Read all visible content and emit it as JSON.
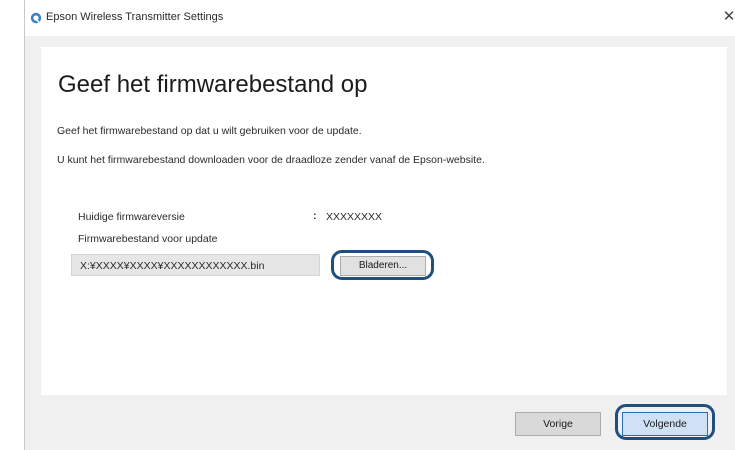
{
  "window": {
    "title": "Epson Wireless Transmitter Settings",
    "close_symbol": "✕",
    "icon": "epson-settings-icon"
  },
  "page": {
    "heading": "Geef het firmwarebestand op",
    "description_1": "Geef het firmwarebestand op dat u wilt gebruiken voor de update.",
    "description_2": "U kunt het firmwarebestand downloaden voor de draadloze zender vanaf de Epson-website."
  },
  "firmware": {
    "current_version_label": "Huidige firmwareversie",
    "separator": ":",
    "current_version_value": "XXXXXXXX",
    "file_label": "Firmwarebestand voor update",
    "file_path": "X:¥XXXX¥XXXX¥XXXXXXXXXXXX.bin",
    "browse_label": "Bladeren..."
  },
  "footer": {
    "back_label": "Vorige",
    "next_label": "Volgende"
  },
  "colors": {
    "highlight": "#1e4f7e",
    "panel": "#ffffff",
    "window_bg": "#f0f0f0"
  }
}
